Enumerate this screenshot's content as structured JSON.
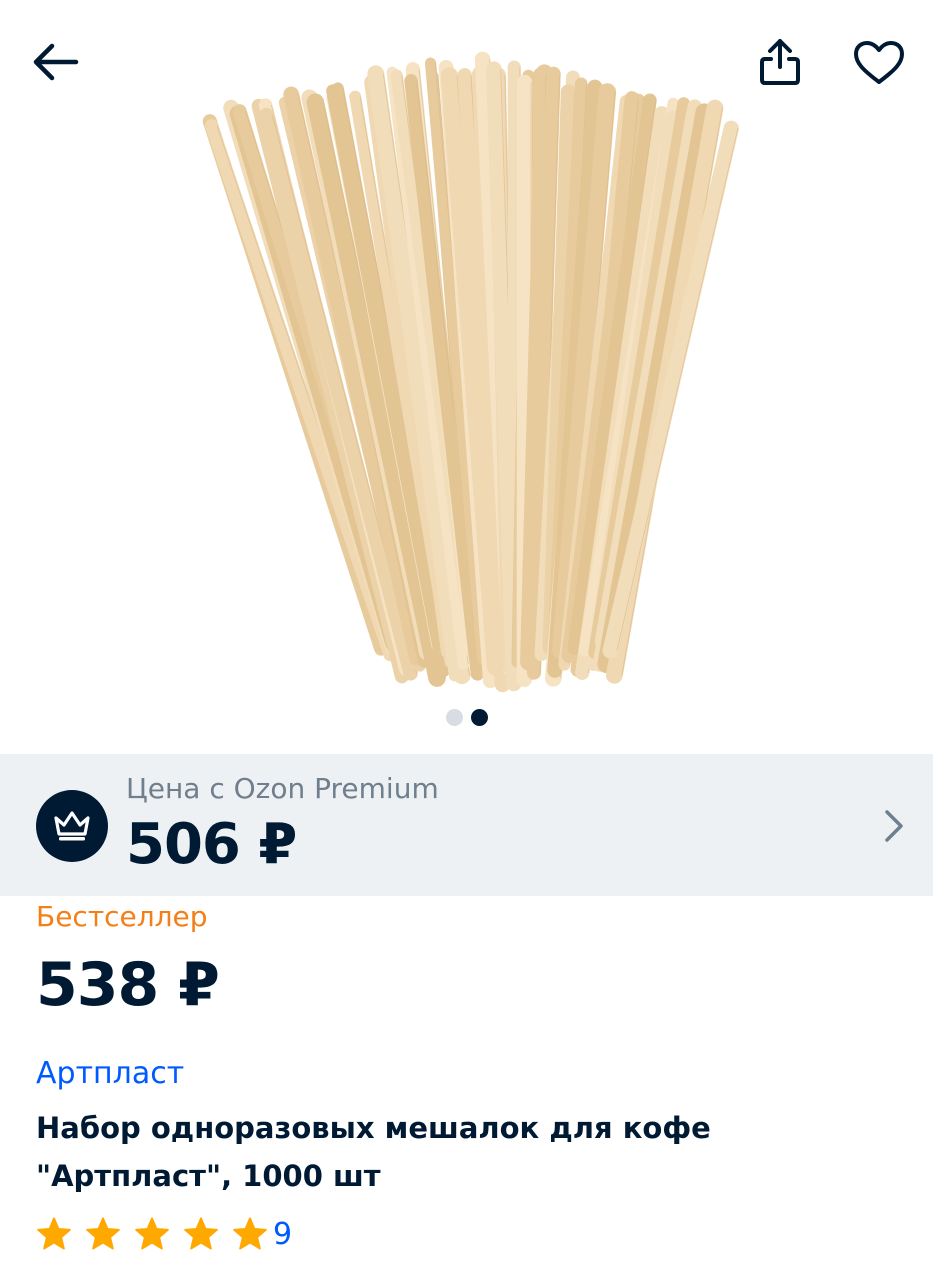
{
  "header": {
    "back_icon": "arrow-left-icon",
    "share_icon": "share-icon",
    "favorite_icon": "heart-icon"
  },
  "gallery": {
    "image_subject": "wooden coffee stir sticks",
    "image_count": 2,
    "active_index": 1
  },
  "premium": {
    "label": "Цена с Ozon Premium",
    "price": "506 ₽",
    "icon": "crown-icon",
    "chevron_icon": "chevron-right-icon"
  },
  "product": {
    "badge": "Бестселлер",
    "price": "538 ₽",
    "brand": "Артпласт",
    "title": "Набор одноразовых мешалок для кофе \"Артпласт\", 1000 шт",
    "rating_stars": 5,
    "reviews_count": "9"
  },
  "colors": {
    "text_primary": "#001a34",
    "accent_blue": "#005bff",
    "badge_orange": "#f57f17",
    "star_orange": "#ffa800",
    "premium_bg": "#eef1f4"
  }
}
